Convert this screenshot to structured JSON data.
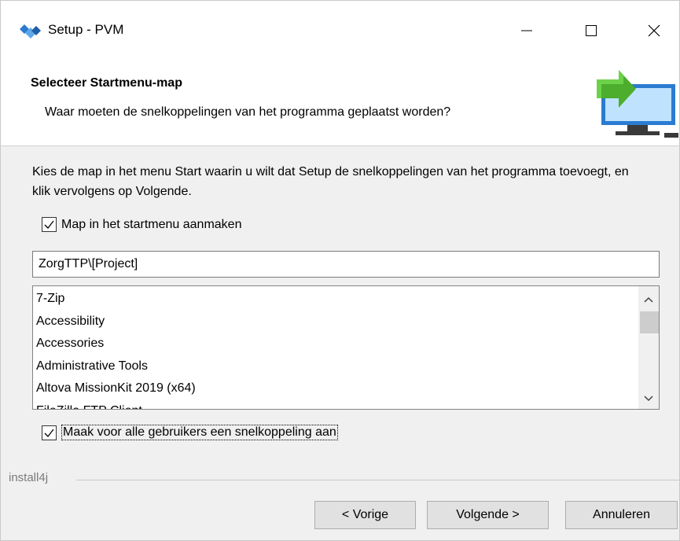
{
  "window": {
    "title": "Setup - PVM",
    "controls": {
      "minimize": "minimize-icon",
      "maximize": "maximize-icon",
      "close": "close-icon"
    }
  },
  "header": {
    "title": "Selecteer Startmenu-map",
    "subtitle": "Waar moeten de snelkoppelingen van het programma geplaatst worden?",
    "icon": "computer-arrow-icon"
  },
  "content": {
    "instruction": "Kies de map in het menu Start waarin u wilt dat Setup de snelkoppelingen van het programma toevoegt, en klik vervolgens op Volgende.",
    "create_folder": {
      "label": "Map in het startmenu aanmaken",
      "checked": true
    },
    "folder_input": {
      "value": "ZorgTTP\\[Project]"
    },
    "folder_list": [
      "7-Zip",
      "Accessibility",
      "Accessories",
      "Administrative Tools",
      "Altova MissionKit 2019 (x64)",
      "FileZilla FTP Client"
    ],
    "all_users": {
      "label": "Maak voor alle gebruikers een snelkoppeling aan",
      "checked": true
    }
  },
  "footer": {
    "brand": "install4j",
    "back_label": "< Vorige",
    "next_label": "Volgende >",
    "cancel_label": "Annuleren"
  },
  "colors": {
    "window_bg": "#f0f0f0",
    "header_bg": "#ffffff",
    "icon_blue": "#2b7bd1",
    "icon_green": "#4cae2c",
    "button_bg": "#e1e1e1"
  }
}
